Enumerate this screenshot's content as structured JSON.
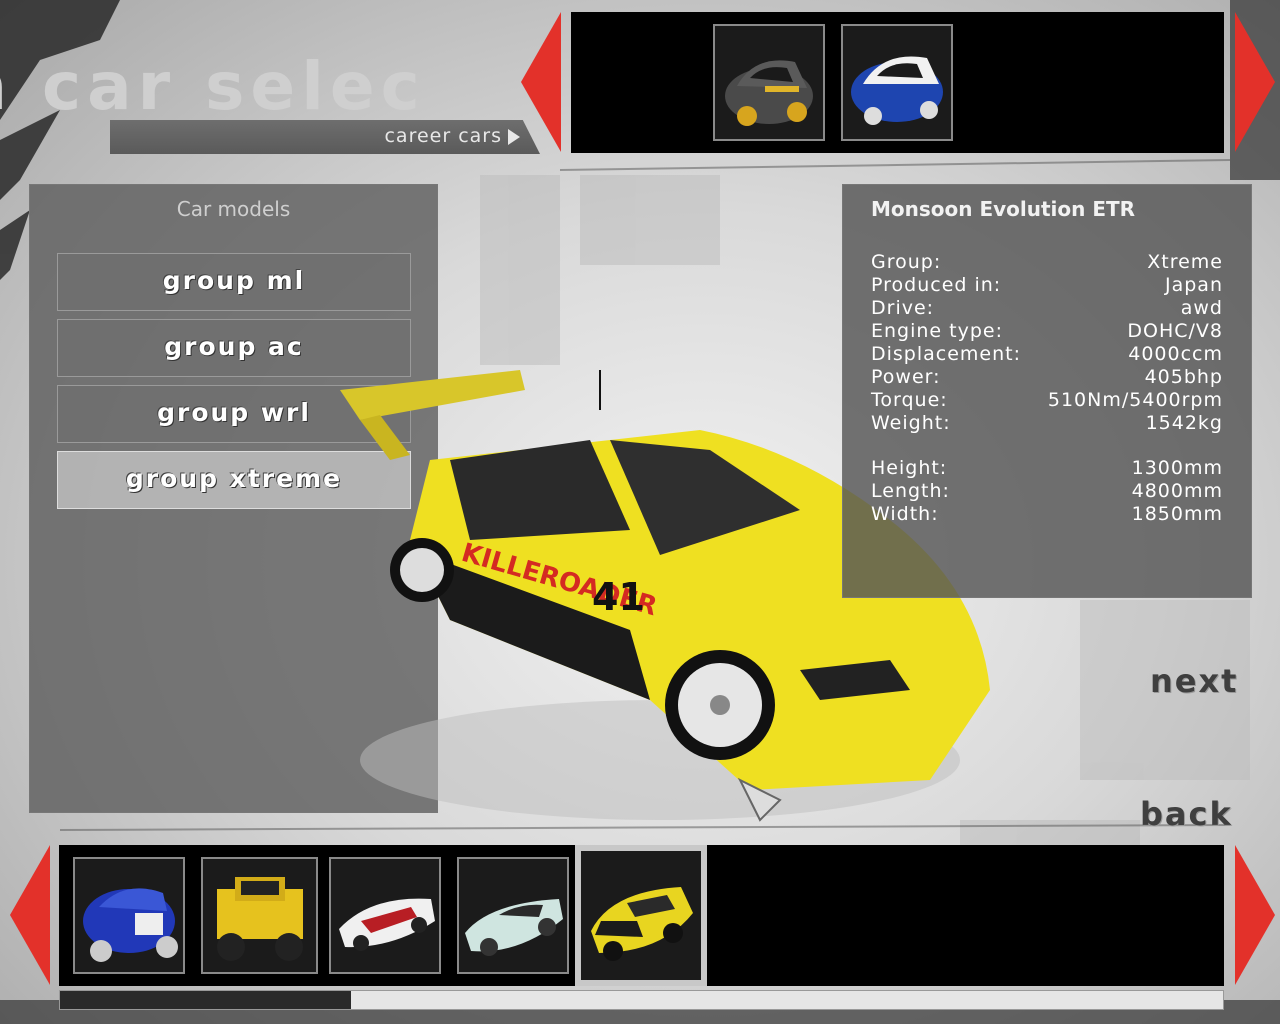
{
  "header": {
    "title": "n   car selec",
    "breadcrumb_label": "career cars"
  },
  "colors": {
    "accent_red": "#e3312a",
    "panel_gray": "#5f5f5f",
    "strip_black": "#000000",
    "selected_frame": "#c8c8c8"
  },
  "top_carousel": {
    "items": [
      {
        "icon": "grey-hatchback-car-thumbnail"
      },
      {
        "icon": "blue-white-rally-car-thumbnail"
      }
    ]
  },
  "models": {
    "title": "Car models",
    "groups": [
      {
        "label": "group ml"
      },
      {
        "label": "group ac"
      },
      {
        "label": "group wrl"
      },
      {
        "label": "group xtreme"
      }
    ],
    "selected_group": "group xtreme"
  },
  "car": {
    "name": "Monsoon Evolution ETR",
    "specs": [
      {
        "key": "Group:",
        "value": "Xtreme"
      },
      {
        "key": "Produced in:",
        "value": "Japan"
      },
      {
        "key": "Drive:",
        "value": "awd"
      },
      {
        "key": "Engine type:",
        "value": "DOHC/V8"
      },
      {
        "key": "Displacement:",
        "value": "4000ccm"
      },
      {
        "key": "Power:",
        "value": "405bhp"
      },
      {
        "key": "Torque:",
        "value": "510Nm/5400rpm"
      },
      {
        "key": "Weight:",
        "value": "1542kg"
      }
    ],
    "dimensions": [
      {
        "key": "Height:",
        "value": "1300mm"
      },
      {
        "key": "Length:",
        "value": "4800mm"
      },
      {
        "key": "Width:",
        "value": "1850mm"
      }
    ],
    "livery_text": "KILLEROADER",
    "number": "41"
  },
  "nav": {
    "next_label": "next",
    "back_label": "back"
  },
  "bottom_carousel": {
    "items": [
      {
        "icon": "blue-buggy-thumbnail"
      },
      {
        "icon": "yellow-truck-thumbnail"
      },
      {
        "icon": "white-red-prototype-thumbnail"
      },
      {
        "icon": "silver-supercar-thumbnail"
      },
      {
        "icon": "yellow-monsoon-evolution-thumbnail",
        "selected": true
      }
    ],
    "scroll_fraction": 0.25
  }
}
